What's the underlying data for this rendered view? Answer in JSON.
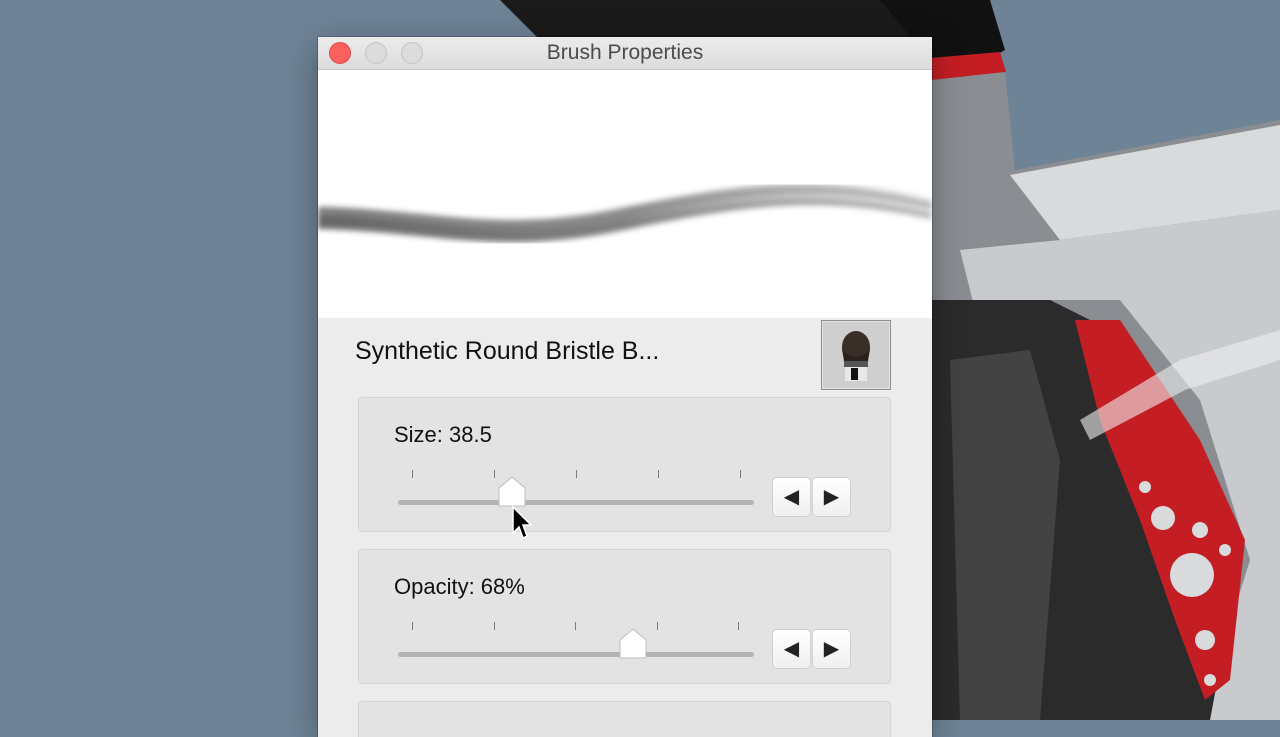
{
  "window": {
    "title": "Brush Properties"
  },
  "brush": {
    "name": "Synthetic Round Bristle B..."
  },
  "controls": {
    "size": {
      "label": "Size: 38.5",
      "slider_fraction": 0.32,
      "decrease_glyph": "◀",
      "increase_glyph": "▶"
    },
    "opacity": {
      "label": "Opacity: 68%",
      "slider_fraction": 0.66,
      "decrease_glyph": "◀",
      "increase_glyph": "▶"
    }
  },
  "icons": {
    "window_close": "close-icon",
    "brush_thumbnail": "brush-icon",
    "pointer": "cursor-icon"
  },
  "colors": {
    "desktop": "#6f8397",
    "close_button": "#fc615d",
    "artwork_accent": "#c41e24"
  }
}
